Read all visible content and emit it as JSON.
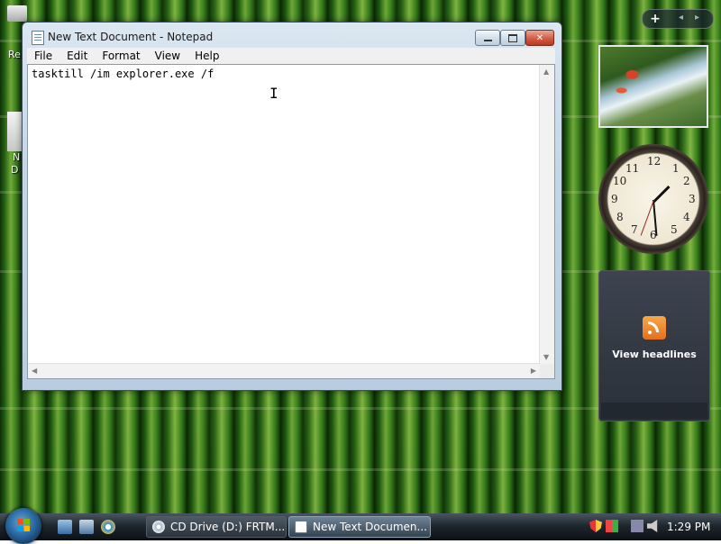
{
  "window": {
    "title": "New Text Document - Notepad",
    "menu": [
      "File",
      "Edit",
      "Format",
      "View",
      "Help"
    ],
    "content": "tasktill /im explorer.exe /f"
  },
  "desktop": {
    "labels": [
      "Re",
      "N",
      "D"
    ]
  },
  "gadgets": {
    "add_label": "+",
    "prev_label": "◂",
    "next_label": "▸",
    "clock_numbers": [
      "12",
      "1",
      "2",
      "3",
      "4",
      "5",
      "6",
      "7",
      "8",
      "9",
      "10",
      "11"
    ],
    "feed_label": "View headlines"
  },
  "taskbar": {
    "tasks": [
      {
        "label": "CD Drive (D:) FRTM...",
        "active": false
      },
      {
        "label": "New Text Documen...",
        "active": true
      }
    ],
    "time": "1:29 PM"
  }
}
